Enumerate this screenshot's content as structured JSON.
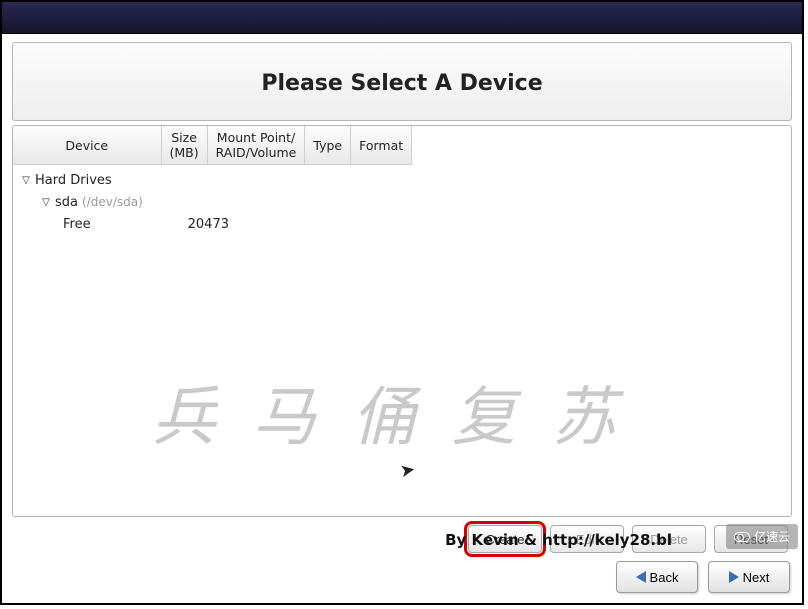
{
  "title": "Please Select A Device",
  "columns": {
    "device": "Device",
    "size": "Size\n(MB)",
    "mount": "Mount Point/\nRAID/Volume",
    "type": "Type",
    "format": "Format"
  },
  "tree": {
    "root_label": "Hard Drives",
    "disk": {
      "name": "sda",
      "path": "(/dev/sda)"
    },
    "free": {
      "label": "Free",
      "size_mb": "20473"
    }
  },
  "watermark": "兵马俑复苏",
  "actions": {
    "create": "Create",
    "edit": "Edit",
    "delete": "Delete",
    "reset": "Reset"
  },
  "nav": {
    "back": "Back",
    "next": "Next"
  },
  "footer_credit": "By Kevin & http://kely28.bl",
  "corner_badge": "亿速云"
}
